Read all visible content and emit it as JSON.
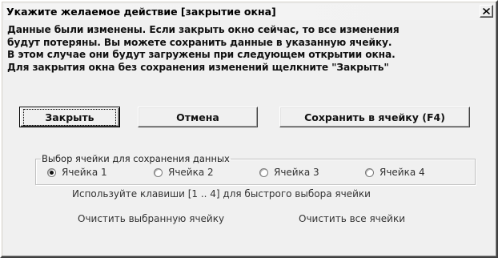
{
  "window": {
    "title": "Укажите желаемое действие [закрытие окна]"
  },
  "message": {
    "lines": [
      "Данные были изменены. Если закрыть окно сейчас, то все изменения",
      "будут потеряны. Вы можете сохранить данные в указанную ячейку.",
      "В этом случае они будут загружены при следующем открытии окна.",
      "Для закрытия окна без сохранения изменений щелкните \"Закрыть\""
    ]
  },
  "buttons": {
    "close": "Закрыть",
    "cancel": "Отмена",
    "save": "Сохранить в ячейку (F4)"
  },
  "slot_group": {
    "legend": "Выбор ячейки для сохранения данных",
    "options": [
      {
        "label": "Ячейка 1",
        "selected": true
      },
      {
        "label": "Ячейка 2",
        "selected": false
      },
      {
        "label": "Ячейка 3",
        "selected": false
      },
      {
        "label": "Ячейка 4",
        "selected": false
      }
    ]
  },
  "hint": "Используйте клавиши [1 .. 4] для быстрого выбора ячейки",
  "actions": {
    "clear_selected": "Очистить выбранную ячейку",
    "clear_all": "Очистить все ячейки"
  },
  "icons": {
    "close": "close-icon"
  }
}
